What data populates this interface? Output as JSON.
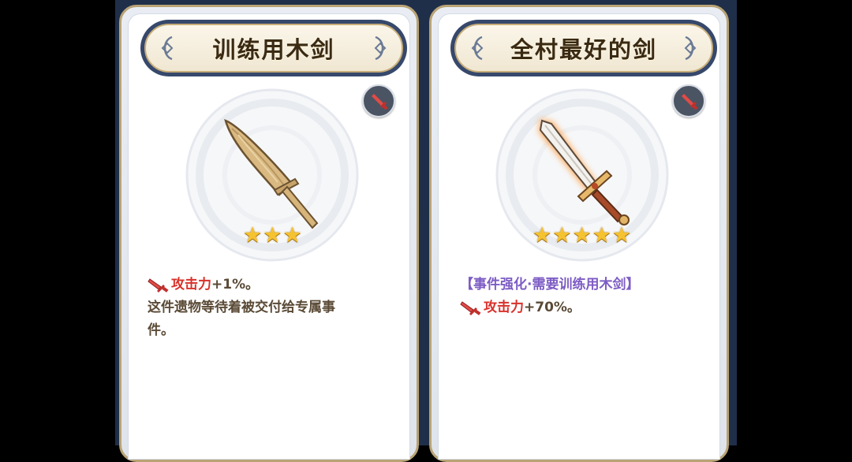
{
  "cards": [
    {
      "title": "训练用木剑",
      "weapon": "wooden-sword",
      "stars": 3,
      "star_glyph": "★",
      "stat_name": "攻击力",
      "stat_value": "+1%。",
      "flavor_line1": "这件遗物等待着被交付给专属事",
      "flavor_line2": "件。"
    },
    {
      "title": "全村最好的剑",
      "weapon": "steel-sword",
      "stars": 5,
      "star_glyph": "★",
      "requirement": "【事件强化·需要训练用木剑】",
      "stat_name": "攻击力",
      "stat_value": "+70%。"
    }
  ],
  "colors": {
    "stat_name": "#d8322b",
    "requirement": "#7d5cc4",
    "star": "#f5c230",
    "banner_frame": "#36486b"
  },
  "icons": {
    "badge": "sword-badge-icon",
    "stat": "sword-stat-icon"
  }
}
